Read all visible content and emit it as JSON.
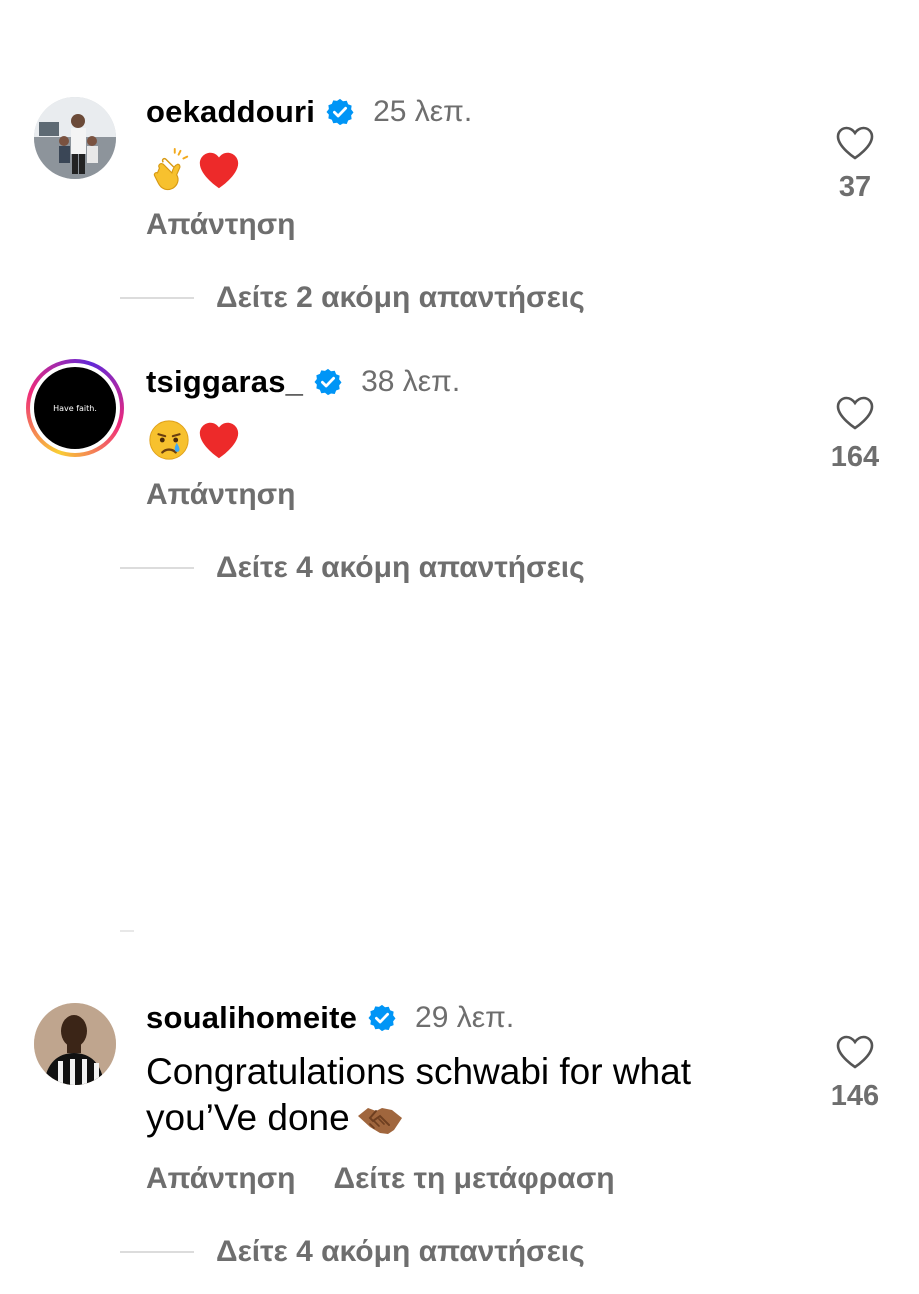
{
  "comments": [
    {
      "username": "oekaddouri",
      "time": "25 λεπ.",
      "reply": "Απάντηση",
      "likes": "37",
      "more_replies": "Δείτε 2 ακόμη απαντήσεις",
      "emojis": [
        "clapping-hands",
        "red-heart"
      ]
    },
    {
      "username": "tsiggaras_",
      "time": "38 λεπ.",
      "avatar_text": "Have faith.",
      "reply": "Απάντηση",
      "likes": "164",
      "more_replies": "Δείτε 4 ακόμη απαντήσεις",
      "emojis": [
        "crying-face",
        "red-heart"
      ]
    },
    {
      "username": "soualihomeite",
      "time": "29 λεπ.",
      "text_line1": "Congratulations schwabi for what",
      "text_line2": "you’Ve done",
      "reply": "Απάντηση",
      "translate": "Δείτε τη μετάφραση",
      "likes": "146",
      "more_replies": "Δείτε 4 ακόμη απαντήσεις",
      "emojis": [
        "handshake"
      ]
    }
  ],
  "colors": {
    "verified": "#0095f6",
    "secondary_text": "#6e6e6e",
    "heart": "#ed2a2a"
  }
}
